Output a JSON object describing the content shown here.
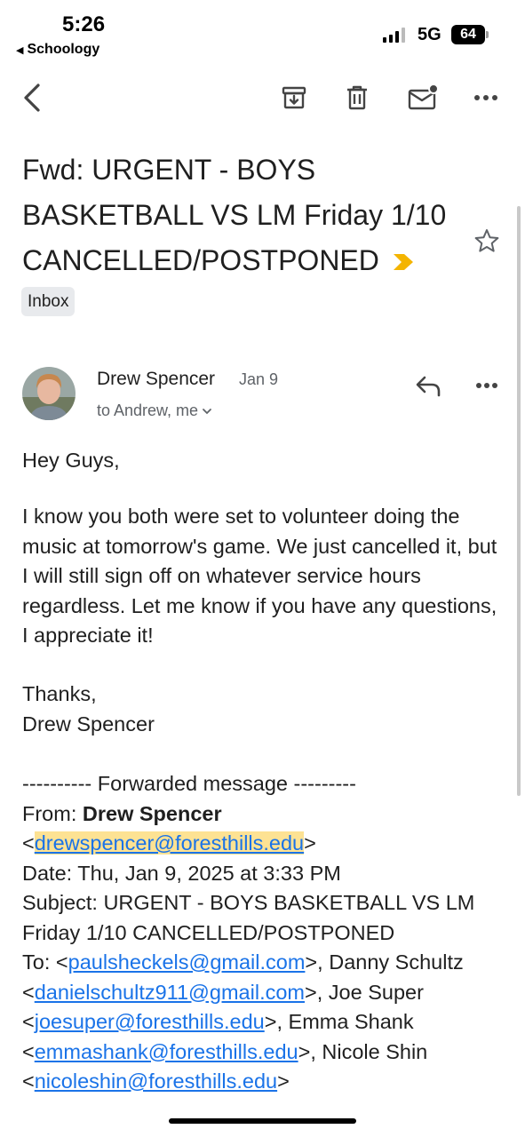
{
  "status": {
    "time": "5:26",
    "back_app": "Schoology",
    "network": "5G",
    "battery": "64"
  },
  "toolbar": {
    "icons": [
      "back-arrow-icon",
      "archive-icon",
      "trash-icon",
      "mark-unread-icon",
      "more-icon"
    ]
  },
  "email": {
    "subject": "Fwd: URGENT - BOYS BASKETBALL VS LM Friday 1/10 CANCELLED/POSTPONED",
    "label": "Inbox",
    "sender": "Drew Spencer",
    "date": "Jan 9",
    "recipients": "to Andrew, me",
    "greeting": "Hey Guys,",
    "paragraph": "I know you both were set to volunteer doing the music at tomorrow's game. We just cancelled it, but I will still sign off on whatever service hours regardless. Let me know if you have any questions, I appreciate it!",
    "thanks": "Thanks,",
    "signature": "Drew Spencer"
  },
  "forwarded": {
    "divider": "---------- Forwarded message ---------",
    "from_label": "From: ",
    "from_name": "Drew Spencer",
    "from_email": "drewspencer@foresthills.edu",
    "date_line": "Date: Thu, Jan 9, 2025 at 3:33 PM",
    "subject_line": "Subject: URGENT - BOYS BASKETBALL VS LM Friday 1/10 CANCELLED/POSTPONED",
    "to_label": "To: ",
    "to_1_email": "paulsheckels@gmail.com",
    "to_2_name": "Danny Schultz",
    "to_2_email": "danielschultz911@gmail.com",
    "to_3_name": "Joe Super",
    "to_3_email": "joesuper@foresthills.edu",
    "to_4_name": "Emma Shank",
    "to_4_email": "emmashank@foresthills.edu",
    "to_5_name": "Nicole Shin",
    "to_5_email": "nicoleshin@foresthills.edu"
  },
  "colors": {
    "link": "#1a73e8",
    "highlight": "#fde293",
    "important": "#f4b400"
  }
}
